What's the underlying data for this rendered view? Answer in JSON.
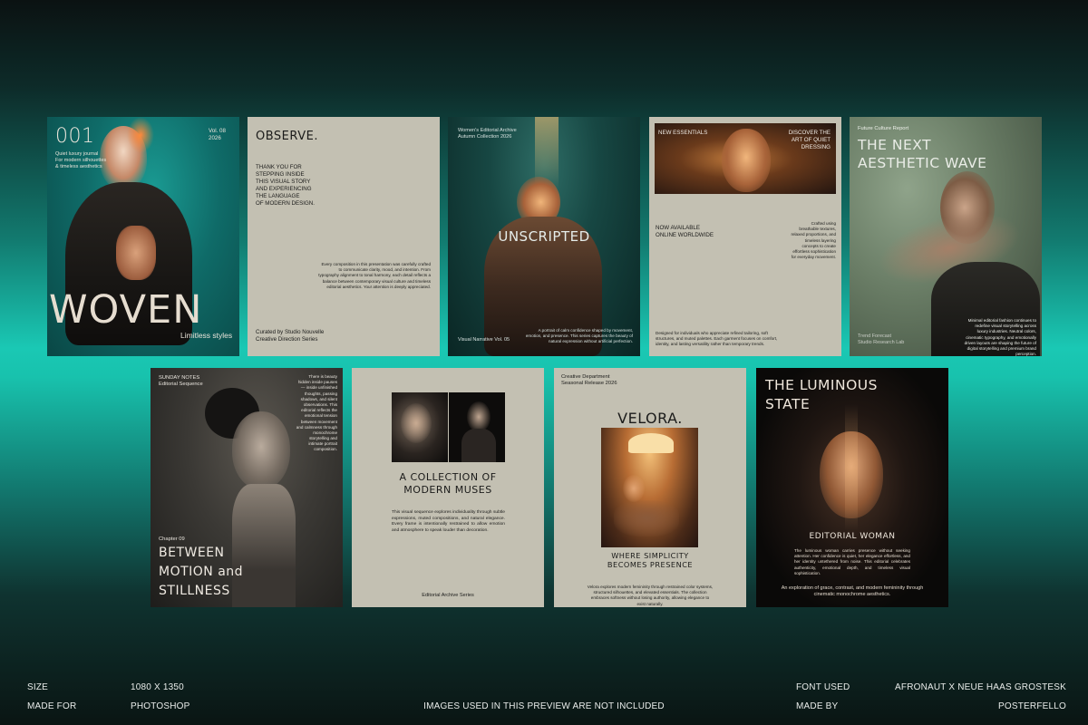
{
  "cards": {
    "woven": {
      "number": "001",
      "vol": "Vol. 08",
      "year": "2026",
      "tagline1": "Quiet luxury journal",
      "tagline2": "For modern silhouettes",
      "tagline3": "& timeless aesthetics",
      "title": "WOVEN",
      "subtitle": "Limitless styles"
    },
    "observe": {
      "title": "OBSERVE.",
      "intro1": "THANK YOU FOR",
      "intro2": "STEPPING INSIDE",
      "intro3": "THIS VISUAL STORY",
      "intro4": "AND EXPERIENCING",
      "intro5": "THE LANGUAGE",
      "intro6": "OF MODERN DESIGN.",
      "body": "Every composition in this presentation was carefully crafted to communicate clarity, mood, and intention. From typography alignment to tonal harmony, each detail reflects a balance between contemporary visual culture and timeless editorial aesthetics. Your attention is deeply appreciated.",
      "credit1": "Curated by Studio Nouvelle",
      "credit2": "Creative Direction Series"
    },
    "unscripted": {
      "top1": "Women's Editorial Archive",
      "top2": "Autumn Collection 2026",
      "title": "UNSCRIPTED",
      "footer_left": "Visual Narrative Vol. 05",
      "footer_right": "A portrait of calm confidence shaped by movement, emotion, and presence. This series captures the beauty of natural expression without artificial perfection."
    },
    "essentials": {
      "left": "NEW ESSENTIALS",
      "right1": "DISCOVER THE",
      "right2": "ART OF QUIET",
      "right3": "DRESSING",
      "avail1": "NOW AVAILABLE",
      "avail2": "ONLINE WORLDWIDE",
      "side": "Crafted using breathable textures, relaxed proportions, and timeless layering concepts to create effortless sophistication for everyday movement.",
      "body": "Designed for individuals who appreciate refined tailoring, soft structures, and muted palettes. Each garment focuses on comfort, identity, and lasting versatility rather than temporary trends."
    },
    "aesthetic": {
      "top": "Future Culture Report",
      "title1": "THE NEXT",
      "title2": "AESTHETIC WAVE",
      "footer1": "Trend Forecast",
      "footer2": "Studio Research Lab",
      "body": "Minimal editorial fashion continues to redefine visual storytelling across luxury industries. Neutral colors, cinematic typography, and emotionally driven layouts are shaping the future of digital storytelling and premium brand perception."
    },
    "sunday": {
      "top1": "SUNDAY NOTES",
      "top2": "Editorial Sequence",
      "side": "There is beauty hidden inside pauses — inside unfinished thoughts, passing shadows, and silent observations. This editorial reflects the emotional tension between movement and calmness through monochrome storytelling and intimate portrait composition.",
      "chapter": "Chapter 09",
      "title1": "BETWEEN",
      "title2": "MOTION and",
      "title3": "STILLNESS"
    },
    "muses": {
      "title1": "A COLLECTION OF",
      "title2": "MODERN MUSES",
      "body": "This visual sequence explores individuality through subtle expressions, muted compositions, and natural elegance. Every frame is intentionally restrained to allow emotion and atmosphere to speak louder than decoration.",
      "footer": "Editorial Archive Series"
    },
    "velora": {
      "top1": "Creative Department",
      "top2": "Seasonal Release 2026",
      "title": "VELORA.",
      "sub1": "WHERE SIMPLICITY",
      "sub2": "BECOMES PRESENCE",
      "body": "Velora explores modern femininity through restrained color systems, structured silhouettes, and elevated essentials. The collection embraces softness without losing authority, allowing elegance to exist naturally."
    },
    "luminous": {
      "title1": "THE LUMINOUS",
      "title2": "STATE",
      "subtitle": "EDITORIAL WOMAN",
      "body": "The luminous woman carries presence without seeking attention. Her confidence is quiet, her elegance effortless, and her identity untethered from noise. This editorial celebrates authenticity, emotional depth, and timeless visual sophistication.",
      "footer": "An exploration of grace, contrast, and modern femininity through cinematic monochrome aesthetics."
    }
  },
  "footer": {
    "size_label": "SIZE",
    "size_value": "1080 X 1350",
    "made_for_label": "MADE FOR",
    "made_for_value": "PHOTOSHOP",
    "notice": "IMAGES USED IN THIS PREVIEW ARE NOT INCLUDED",
    "font_label": "FONT USED",
    "font_value": "AFRONAUT X NEUE HAAS GROSTESK",
    "made_by_label": "MADE BY",
    "made_by_value": "POSTERFELLO"
  },
  "colors": {
    "paper": "#c3c0b2",
    "teal": "#1ac8b4",
    "dark": "#0b1212"
  }
}
